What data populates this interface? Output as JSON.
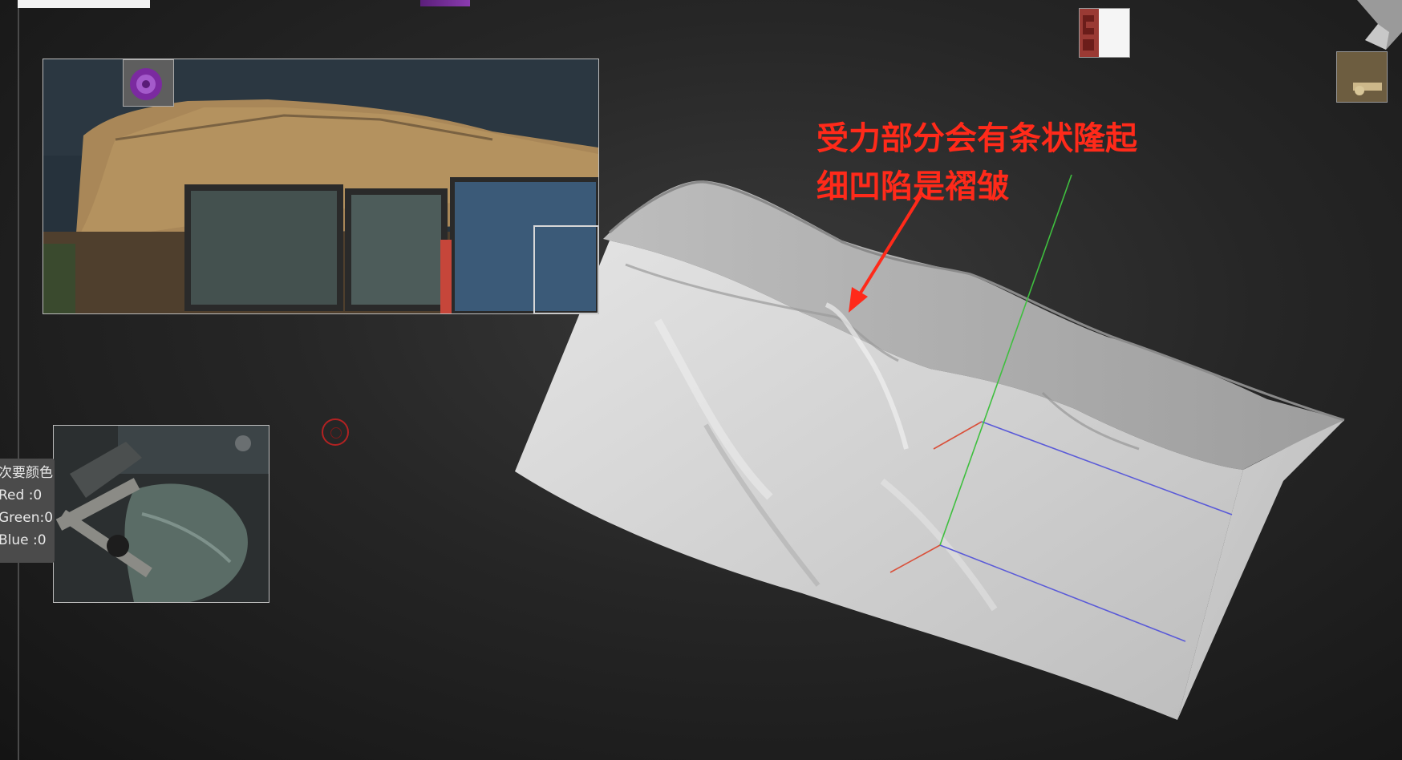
{
  "annotation": {
    "line1": "受力部分会有条状隆起",
    "line2": "细凹陷是褶皱"
  },
  "color_tooltip": {
    "title": "次要颜色",
    "red": "Red :0",
    "green": "Green:0",
    "blue": "Blue :0"
  },
  "colors": {
    "annotation": "#ff2a1a",
    "axis_x": "#d9503a",
    "axis_y": "#3fbf3f",
    "axis_z": "#5a5ad8",
    "mesh": "#d8d8d8",
    "background": "#262626"
  },
  "icons": {
    "target_marker": "brush-target-icon",
    "material_chip_top": "material-swatch-icon",
    "material_chip_right": "texture-thumbnail-icon"
  }
}
